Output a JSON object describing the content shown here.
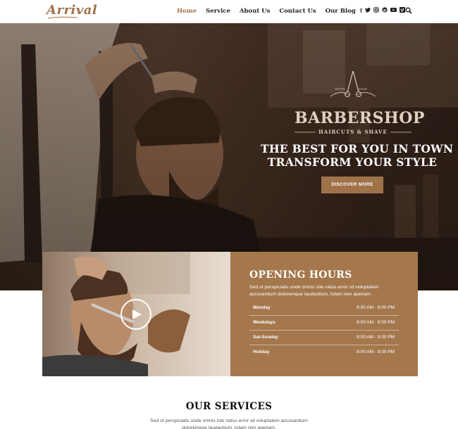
{
  "header": {
    "logo": "Arrival",
    "nav": [
      {
        "label": "Home",
        "active": true
      },
      {
        "label": "Service",
        "active": false
      },
      {
        "label": "About Us",
        "active": false
      },
      {
        "label": "Contact Us",
        "active": false
      },
      {
        "label": "Our Blog",
        "active": false
      }
    ],
    "social_icons": [
      "facebook-icon",
      "twitter-icon",
      "instagram-icon",
      "pinterest-icon",
      "youtube-icon",
      "vimeo-icon"
    ],
    "social_glyphs": [
      "f",
      "𝕥",
      "◎",
      "℗",
      "▶",
      "v"
    ]
  },
  "hero": {
    "badge_estd": "ESTD",
    "badge_year": "2019",
    "badge_title": "BARBERSHOP",
    "badge_subtitle": "HAIRCUTS & SHAVE",
    "headline_line1": "THE BEST FOR YOU IN TOWN",
    "headline_line2": "TRANSFORM YOUR STYLE",
    "cta_label": "DISCOVER MORE"
  },
  "hours": {
    "title": "OPENING HOURS",
    "description": "Sed ut perspiciatis unde omnis iste natus error sit voluptatem accusantium doloremque laudantium, totam rem aperiam.",
    "rows": [
      {
        "day": "Monday",
        "time": "8:00 AM - 9:00 PM"
      },
      {
        "day": "Weekdays",
        "time": "8:00 AM - 9:00 PM"
      },
      {
        "day": "Sat-Sunday",
        "time": "8:00 AM - 9:00 PM"
      },
      {
        "day": "Holiday",
        "time": "8:00 AM - 9:00 PM"
      }
    ]
  },
  "services": {
    "title": "OUR SERVICES",
    "description": "Sed ut perspiciatis unde omnis iste natus error sit voluptatem accusantium doloremque laudantium, totam rem aperiam."
  },
  "colors": {
    "accent": "#a0724a",
    "hours_bg": "#a4774c",
    "text_dark": "#222222"
  }
}
